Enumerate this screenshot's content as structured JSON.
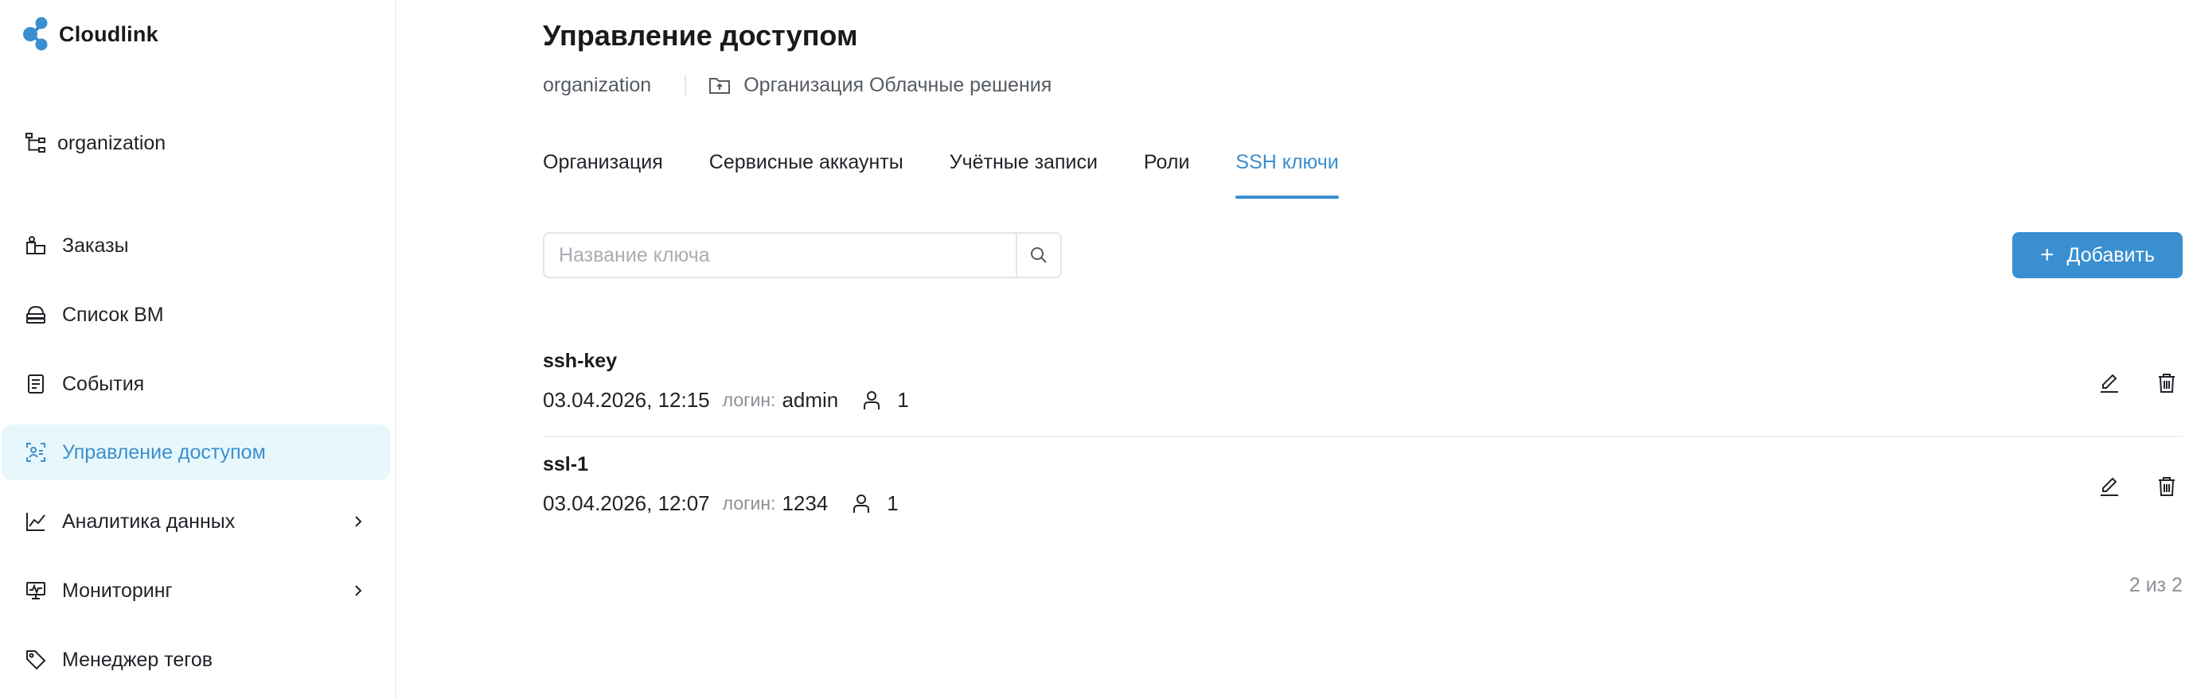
{
  "app": {
    "name": "Cloudlink"
  },
  "sidebar": {
    "org_label": "organization",
    "items": [
      {
        "label": "Заказы",
        "icon": "orders-icon",
        "active": false,
        "has_children": false
      },
      {
        "label": "Список ВМ",
        "icon": "vm-list-icon",
        "active": false,
        "has_children": false
      },
      {
        "label": "События",
        "icon": "events-icon",
        "active": false,
        "has_children": false
      },
      {
        "label": "Управление доступом",
        "icon": "access-icon",
        "active": true,
        "has_children": false
      },
      {
        "label": "Аналитика данных",
        "icon": "analytics-icon",
        "active": false,
        "has_children": true
      },
      {
        "label": "Мониторинг",
        "icon": "monitoring-icon",
        "active": false,
        "has_children": true
      },
      {
        "label": "Менеджер тегов",
        "icon": "tag-icon",
        "active": false,
        "has_children": false
      }
    ]
  },
  "page": {
    "title": "Управление доступом",
    "breadcrumb": {
      "org": "organization",
      "folder": "Организация Облачные решения"
    },
    "tabs": [
      {
        "label": "Организация",
        "active": false
      },
      {
        "label": "Сервисные аккаунты",
        "active": false
      },
      {
        "label": "Учётные записи",
        "active": false
      },
      {
        "label": "Роли",
        "active": false
      },
      {
        "label": "SSH ключи",
        "active": true
      }
    ],
    "search": {
      "placeholder": "Название ключа",
      "value": ""
    },
    "add_label": "Добавить",
    "keys": [
      {
        "name": "ssh-key",
        "date": "03.04.2026, 12:15",
        "login_label": "логин:",
        "login": "admin",
        "users": "1"
      },
      {
        "name": "ssl-1",
        "date": "03.04.2026, 12:07",
        "login_label": "логин:",
        "login": "1234",
        "users": "1"
      }
    ],
    "pagination": "2 из 2"
  },
  "colors": {
    "accent": "#3a8fd0",
    "active_bg": "#e8f7fb",
    "muted": "#8a9096",
    "border": "#e3e5e8"
  }
}
